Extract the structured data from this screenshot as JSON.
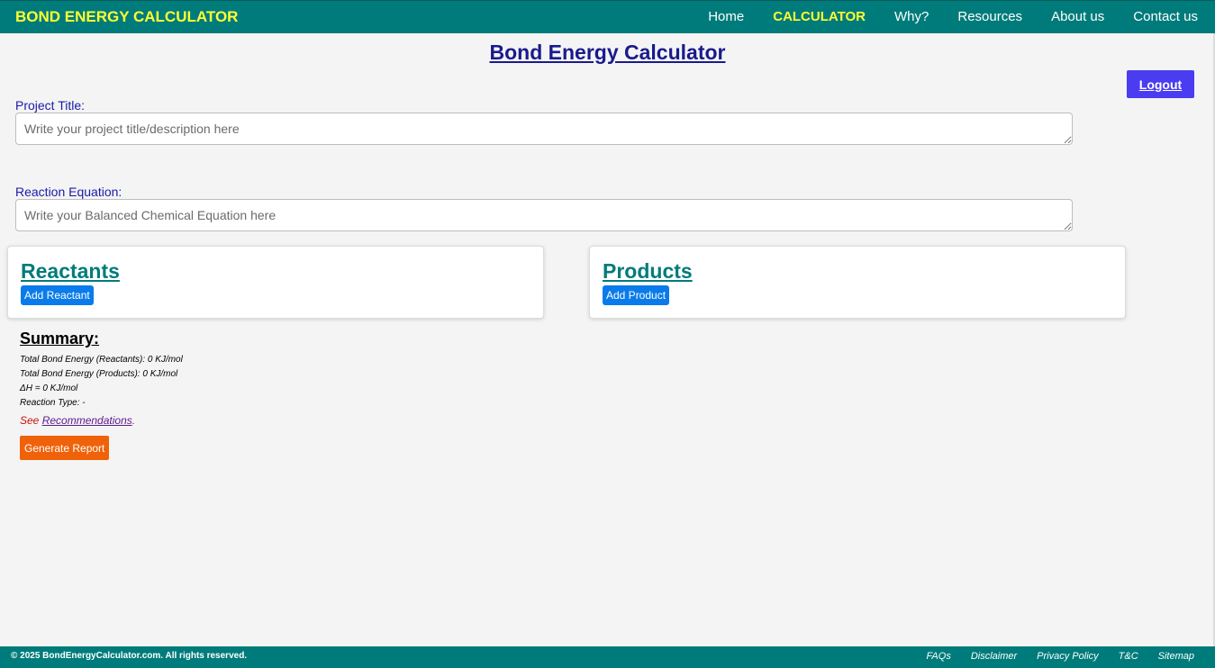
{
  "navbar": {
    "brand": "BOND ENERGY CALCULATOR",
    "links": [
      {
        "label": "Home",
        "active": false
      },
      {
        "label": "CALCULATOR",
        "active": true
      },
      {
        "label": "Why?",
        "active": false
      },
      {
        "label": "Resources",
        "active": false
      },
      {
        "label": "About us",
        "active": false
      },
      {
        "label": "Contact us",
        "active": false
      }
    ]
  },
  "page": {
    "title": "Bond Energy Calculator",
    "logout_label": "Logout"
  },
  "form": {
    "project_title_label": "Project Title:",
    "project_title_placeholder": "Write your project title/description here",
    "project_title_value": "",
    "equation_label": "Reaction Equation:",
    "equation_placeholder": "Write your Balanced Chemical Equation here",
    "equation_value": ""
  },
  "reactants": {
    "title": "Reactants",
    "add_label": "Add Reactant"
  },
  "products": {
    "title": "Products",
    "add_label": "Add Product"
  },
  "summary": {
    "title": "Summary:",
    "reactants_energy": "Total Bond Energy (Reactants): 0 KJ/mol",
    "products_energy": "Total Bond Energy (Products): 0 KJ/mol",
    "delta_h": "ΔH = 0 KJ/mol",
    "reaction_type": "Reaction Type: -",
    "see_prefix": "See ",
    "recommendations_link": "Recommendations",
    "see_suffix": ".",
    "generate_label": "Generate Report"
  },
  "footer": {
    "copyright": "© 2025 BondEnergyCalculator.com. All rights reserved.",
    "links": [
      "FAQs",
      "Disclaimer",
      "Privacy Policy",
      "T&C",
      "Sitemap"
    ]
  },
  "colors": {
    "nav_bg": "#007b7b",
    "brand_yellow": "#ffff33",
    "logout_bg": "#4a3cf0",
    "add_btn_bg": "#0a7bea",
    "report_btn_bg": "#f0620a"
  }
}
